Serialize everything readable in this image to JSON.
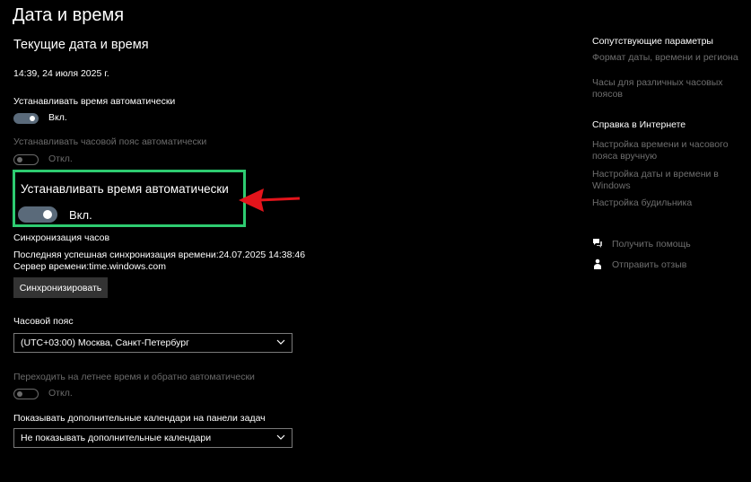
{
  "page": {
    "title": "Дата и время",
    "section_title": "Текущие дата и время",
    "current_datetime": "14:39, 24 июля 2025 г."
  },
  "auto_time": {
    "label": "Устанавливать время автоматически",
    "state_label": "Вкл.",
    "on": true
  },
  "auto_timezone": {
    "label": "Устанавливать часовой пояс автоматически",
    "state_label": "Откл.",
    "on": false
  },
  "highlight": {
    "label": "Устанавливать время автоматически",
    "state_label": "Вкл.",
    "border_color": "#2ecc71",
    "arrow_color": "#e3141b"
  },
  "sync": {
    "title": "Синхронизация часов",
    "last_sync": "Последняя успешная синхронизация времени:24.07.2025 14:38:46",
    "server": "Сервер времени:time.windows.com",
    "button_label": "Синхронизировать"
  },
  "timezone": {
    "label": "Часовой пояс",
    "selected": "(UTC+03:00) Москва, Санкт-Петербург"
  },
  "dst": {
    "label": "Переходить на летнее время и обратно автоматически",
    "state_label": "Откл.",
    "on": false
  },
  "calendars": {
    "label": "Показывать дополнительные календари на панели задач",
    "selected": "Не показывать дополнительные календари"
  },
  "sidebar": {
    "related_title": "Сопутствующие параметры",
    "related_links": [
      "Формат даты, времени и региона",
      "Часы для различных часовых поясов"
    ],
    "help_title": "Справка в Интернете",
    "help_links": [
      "Настройка времени и часового пояса вручную",
      "Настройка даты и времени в Windows",
      "Настройка будильника"
    ],
    "get_help": "Получить помощь",
    "feedback": "Отправить отзыв"
  }
}
